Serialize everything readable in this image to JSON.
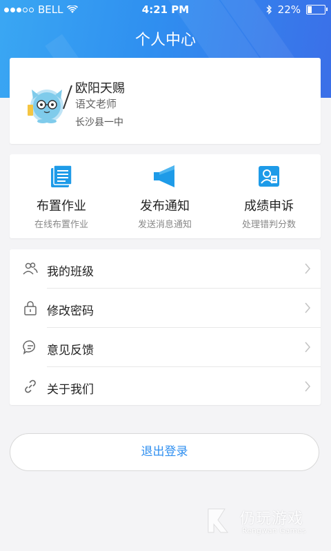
{
  "status_bar": {
    "carrier": "BELL",
    "time": "4:21 PM",
    "battery_percent": "22%",
    "battery_level": 0.22,
    "icons": [
      "signal-dots-icon",
      "wifi-icon",
      "bluetooth-icon",
      "battery-icon"
    ]
  },
  "header": {
    "title": "个人中心"
  },
  "profile": {
    "name": "欧阳天赐",
    "role": "语文老师",
    "school": "长沙县一中",
    "avatar_icon": "teacher-mascot-avatar"
  },
  "actions": [
    {
      "label": "布置作业",
      "sub": "在线布置作业",
      "icon": "homework-icon"
    },
    {
      "label": "发布通知",
      "sub": "发送消息通知",
      "icon": "megaphone-icon"
    },
    {
      "label": "成绩申诉",
      "sub": "处理错判分数",
      "icon": "appeal-icon"
    }
  ],
  "menu": [
    {
      "label": "我的班级",
      "icon": "users-icon"
    },
    {
      "label": "修改密码",
      "icon": "lock-icon"
    },
    {
      "label": "意见反馈",
      "icon": "feedback-icon"
    },
    {
      "label": "关于我们",
      "icon": "link-icon"
    }
  ],
  "logout": {
    "label": "退出登录"
  },
  "watermark": {
    "text_cn": "仍玩游戏",
    "text_en": "Rengwan Games"
  },
  "colors": {
    "accent": "#2f8ff0",
    "header_gradient_start": "#3aa7f3",
    "header_gradient_end": "#3b6fe8",
    "background": "#f4f4f6",
    "action_icon": "#1e9be8"
  }
}
